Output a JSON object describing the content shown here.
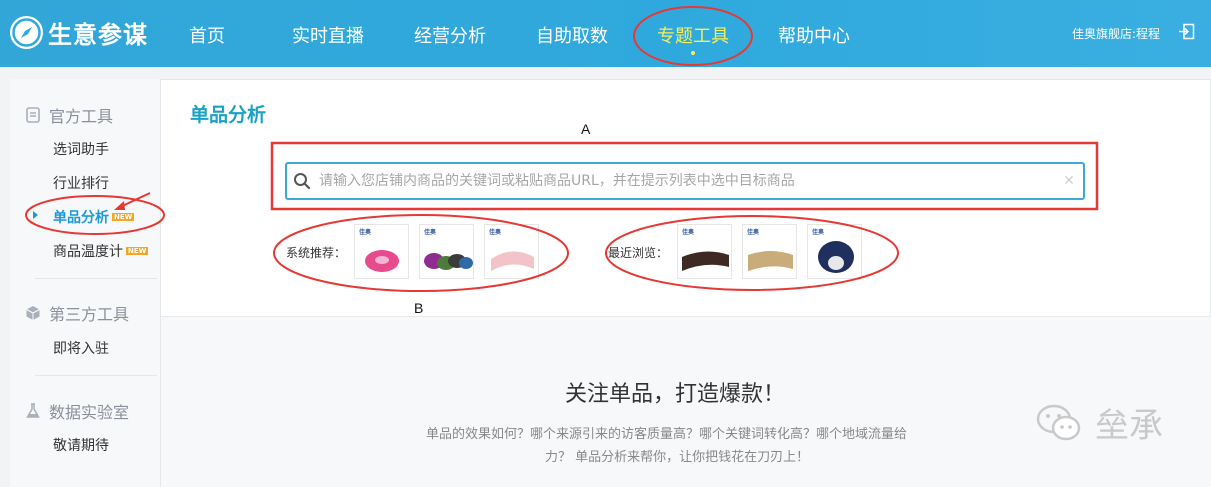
{
  "brand": {
    "name": "生意参谋",
    "logo_icon": "compass-icon"
  },
  "nav": {
    "items": [
      {
        "label": "首页"
      },
      {
        "label": "实时直播"
      },
      {
        "label": "经营分析"
      },
      {
        "label": "自助取数"
      },
      {
        "label": "专题工具",
        "active": true
      },
      {
        "label": "帮助中心"
      }
    ],
    "active_color": "#f7ee5b"
  },
  "user": {
    "text": "佳奥旗舰店:程程",
    "logout_icon": "logout-icon"
  },
  "sidebar": {
    "sections": [
      {
        "title": "官方工具",
        "icon": "document-icon",
        "items": [
          {
            "label": "选词助手"
          },
          {
            "label": "行业排行"
          },
          {
            "label": "单品分析",
            "badge": "NEW",
            "active": true
          },
          {
            "label": "商品温度计",
            "badge": "NEW"
          }
        ]
      },
      {
        "title": "第三方工具",
        "icon": "cube-icon",
        "items": [
          {
            "label": "即将入驻"
          }
        ]
      },
      {
        "title": "数据实验室",
        "icon": "flask-icon",
        "items": [
          {
            "label": "敬请期待"
          }
        ]
      }
    ]
  },
  "main": {
    "title": "单品分析",
    "search": {
      "placeholder": "请输入您店铺内商品的关键词或粘贴商品URL，并在提示列表中选中目标商品"
    },
    "recommend_label": "系统推荐：",
    "recent_label": "最近浏览：",
    "thumb_brand": "佳奥",
    "slogan": "关注单品，打造爆款！",
    "desc_line1": "单品的效果如何？哪个来源引来的访客质量高？哪个关键词转化高？哪个地域流量给",
    "desc_line2": "力？ 单品分析来帮你，让你把钱花在刀刃上！"
  },
  "annotations": {
    "a": "A",
    "b": "B"
  },
  "watermark": {
    "text": "垒承"
  },
  "colors": {
    "accent": "#2fa9dd",
    "title": "#1aa1c5",
    "highlight_ring": "#e53935"
  }
}
